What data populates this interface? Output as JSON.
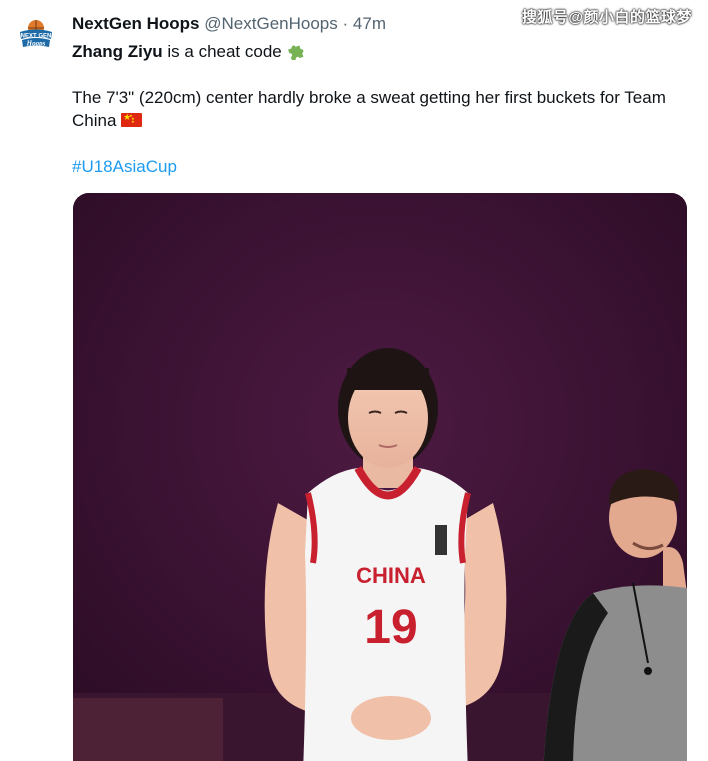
{
  "tweet": {
    "avatar_text": [
      "NEXT GEN",
      "Hoops"
    ],
    "display_name": "NextGen Hoops",
    "handle": "@NextGenHoops",
    "separator": "·",
    "time": "47m",
    "watermark": "搜狐号@颜小白的篮球梦",
    "line1_bold": "Zhang Ziyu",
    "line1_rest": " is a cheat code ",
    "line2": "The 7'3\" (220cm) center hardly broke a sweat getting her first buckets for Team China ",
    "hashtag": "#U18AsiaCup"
  },
  "media": {
    "jersey_team": "CHINA",
    "jersey_number": "19"
  },
  "colors": {
    "hashtag": "#1d9bf0",
    "text": "#0f1419",
    "muted": "#536471",
    "media_bg": "#3b1333",
    "jersey_red": "#c8202f"
  },
  "icons": {
    "puzzle": "puzzle-piece-emoji",
    "flag": "china-flag-emoji"
  }
}
